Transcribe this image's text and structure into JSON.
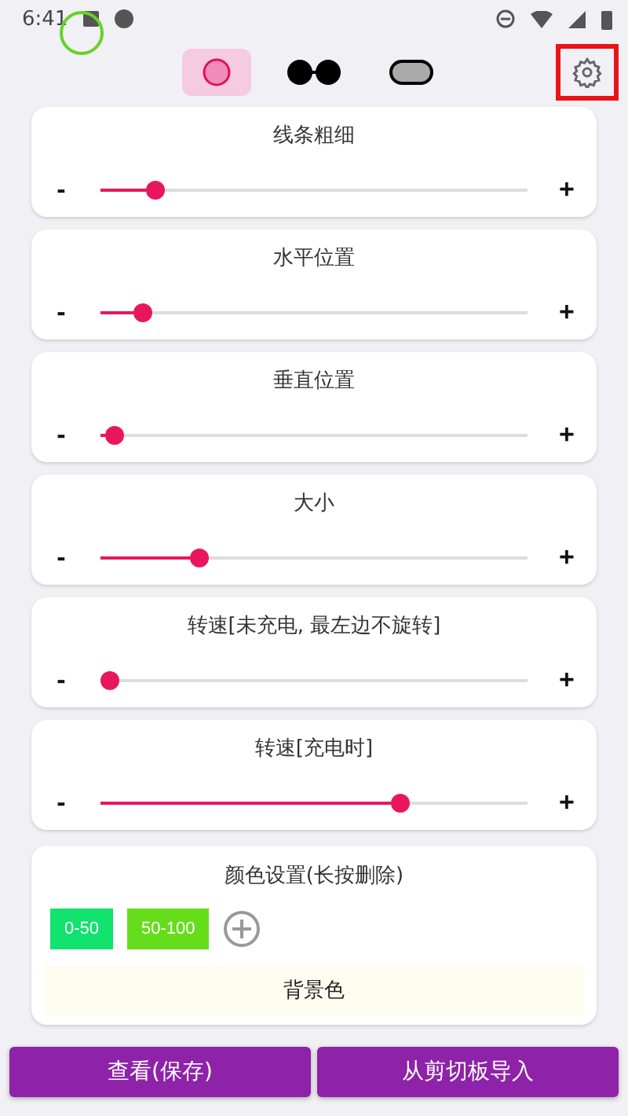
{
  "status_bar": {
    "time": "6:41"
  },
  "modes": [
    {
      "kind": "ring",
      "selected": true
    },
    {
      "kind": "dots",
      "selected": false
    },
    {
      "kind": "pill",
      "selected": false
    }
  ],
  "sliders": [
    {
      "label": "线条粗细",
      "minus": "-",
      "plus": "+",
      "level": 0.11
    },
    {
      "label": "水平位置",
      "minus": "-",
      "plus": "+",
      "level": 0.08
    },
    {
      "label": "垂直位置",
      "minus": "-",
      "plus": "+",
      "level": 0.01
    },
    {
      "label": "大小",
      "minus": "-",
      "plus": "+",
      "level": 0.22
    },
    {
      "label": "转速[未充电, 最左边不旋转]",
      "minus": "-",
      "plus": "+",
      "level": 0
    },
    {
      "label": "转速[充电时]",
      "minus": "-",
      "plus": "+",
      "level": 0.71
    }
  ],
  "colors": {
    "title": "颜色设置(长按删除)",
    "items": [
      {
        "label": "0-50",
        "color": "#12e26e"
      },
      {
        "label": "50-100",
        "color": "#66dd1a"
      }
    ],
    "background": "背景色"
  },
  "buttons": [
    "查看(保存)",
    "从剪切板导入"
  ]
}
